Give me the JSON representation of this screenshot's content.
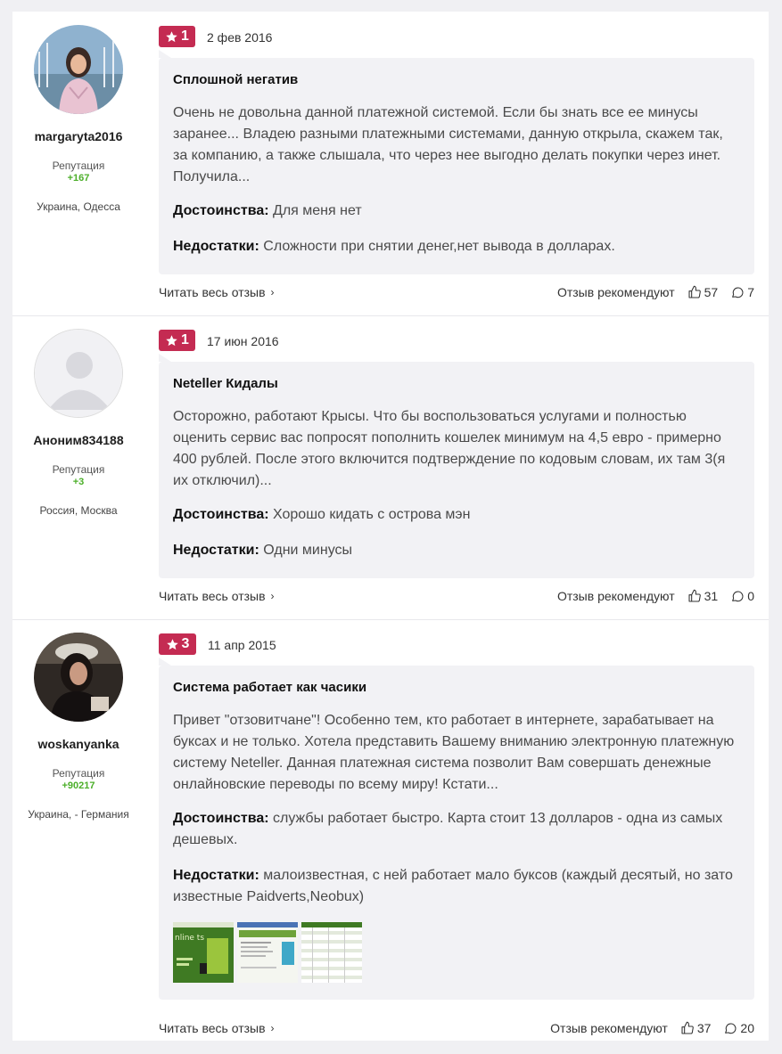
{
  "reviews": [
    {
      "username": "margaryta2016",
      "reputation_label": "Репутация",
      "reputation": "+167",
      "location": "Украина, Одесса",
      "rating": "1",
      "date": "2 фев 2016",
      "title": "Сплошной негатив",
      "text": "Очень не довольна данной платежной системой. Если бы знать все ее минусы заранее... Владею разными платежными системами, данную открыла, скажем так, за компанию, а также слышала, что через нее выгодно делать покупки через инет. Получила...",
      "pros_label": "Достоинства:",
      "pros": "Для меня нет",
      "cons_label": "Недостатки:",
      "cons": "Сложности при снятии денег,нет вывода в долларах.",
      "read_more": "Читать весь отзыв",
      "recommend_label": "Отзыв рекомендуют",
      "likes": "57",
      "comments": "7"
    },
    {
      "username": "Аноним834188",
      "reputation_label": "Репутация",
      "reputation": "+3",
      "location": "Россия, Москва",
      "rating": "1",
      "date": "17 июн 2016",
      "title": "Neteller Кидалы",
      "text": "Осторожно, работают Крысы. Что бы воспользоваться услугами и полностью оценить сервис вас попросят пополнить кошелек минимум на 4,5 евро - примерно 400 рублей. После этого включится подтверждение по кодовым словам, их там 3(я их отключил)...",
      "pros_label": "Достоинства:",
      "pros": "Хорошо кидать с острова мэн",
      "cons_label": "Недостатки:",
      "cons": "Одни минусы",
      "read_more": "Читать весь отзыв",
      "recommend_label": "Отзыв рекомендуют",
      "likes": "31",
      "comments": "0"
    },
    {
      "username": "woskanyanka",
      "reputation_label": "Репутация",
      "reputation": "+90217",
      "location": "Украина, - Германия",
      "rating": "3",
      "date": "11 апр 2015",
      "title": "Система работает как часики",
      "text": "Привет \"отзовитчане\"! Особенно тем, кто работает в интернете, зарабатывает на буксах и не только. Хотела представить Вашему вниманию электронную платежную систему Neteller. Данная платежная система позволит Вам совершать денежные онлайновские переводы по всему миру! Кстати...",
      "pros_label": "Достоинства:",
      "pros": "службы работает быстро. Карта стоит 13 долларов - одна из самых дешевых.",
      "cons_label": "Недостатки:",
      "cons": "малоизвестная, с ней работает мало буксов (каждый десятый, но зато известные Paidverts,Neobux)",
      "thumb_text": "nline ts",
      "read_more": "Читать весь отзыв",
      "recommend_label": "Отзыв рекомендуют",
      "likes": "37",
      "comments": "20"
    }
  ],
  "colors": {
    "badge": "#c42b52",
    "reputation": "#4caf2a",
    "bubble": "#f2f2f5"
  }
}
